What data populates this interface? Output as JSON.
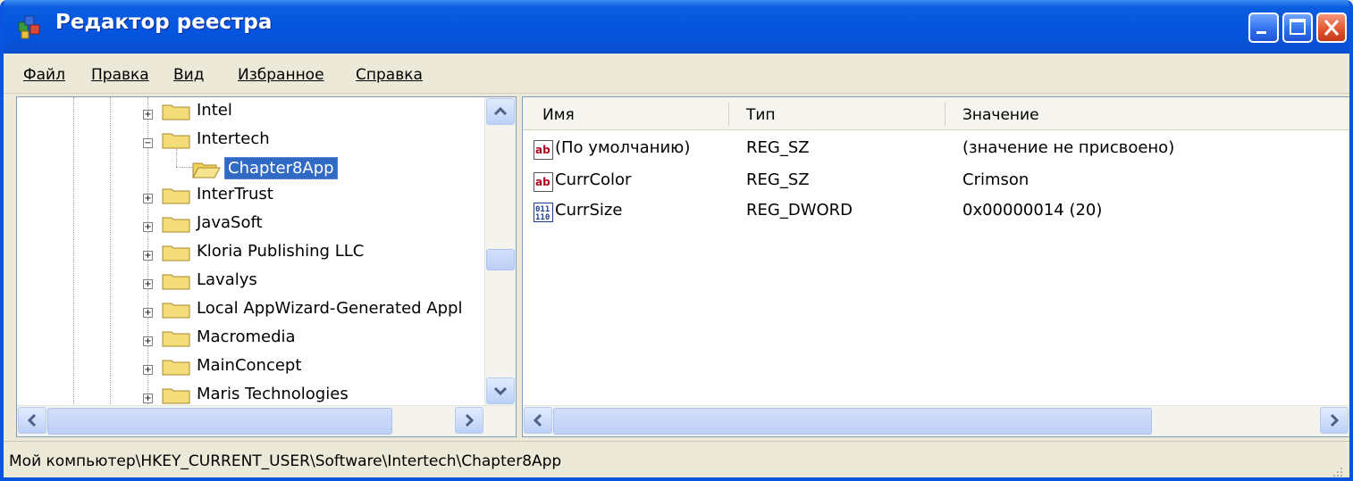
{
  "window": {
    "title": "Редактор реестра",
    "app_icon": "regedit-icon"
  },
  "menu": [
    {
      "label": "Файл"
    },
    {
      "label": "Правка"
    },
    {
      "label": "Вид"
    },
    {
      "label": "Избранное"
    },
    {
      "label": "Справка"
    }
  ],
  "tree": {
    "items": [
      {
        "label": "Intel",
        "expander": "+",
        "selected": false
      },
      {
        "label": "Intertech",
        "expander": "−",
        "selected": false
      },
      {
        "label": "Chapter8App",
        "expander": "",
        "selected": true
      },
      {
        "label": "InterTrust",
        "expander": "+",
        "selected": false
      },
      {
        "label": "JavaSoft",
        "expander": "+",
        "selected": false
      },
      {
        "label": "Kloria Publishing LLC",
        "expander": "+",
        "selected": false
      },
      {
        "label": "Lavalys",
        "expander": "+",
        "selected": false
      },
      {
        "label": "Local AppWizard-Generated Appl",
        "expander": "+",
        "selected": false
      },
      {
        "label": "Macromedia",
        "expander": "+",
        "selected": false
      },
      {
        "label": "MainConcept",
        "expander": "+",
        "selected": false
      },
      {
        "label": "Maris Technologies",
        "expander": "+",
        "selected": false
      }
    ]
  },
  "list": {
    "columns": {
      "name": "Имя",
      "type": "Тип",
      "value": "Значение"
    },
    "rows": [
      {
        "name": "(По умолчанию)",
        "type": "REG_SZ",
        "value": "(значение не присвоено)",
        "icon": "string-value-icon"
      },
      {
        "name": "CurrColor",
        "type": "REG_SZ",
        "value": "Crimson",
        "icon": "string-value-icon"
      },
      {
        "name": "CurrSize",
        "type": "REG_DWORD",
        "value": "0x00000014 (20)",
        "icon": "dword-value-icon"
      }
    ]
  },
  "statusbar": {
    "path": "Мой компьютер\\HKEY_CURRENT_USER\\Software\\Intertech\\Chapter8App"
  },
  "colors": {
    "titlebar": "#0554e0",
    "selection": "#316ac5",
    "folder": "#f5dc7a"
  }
}
